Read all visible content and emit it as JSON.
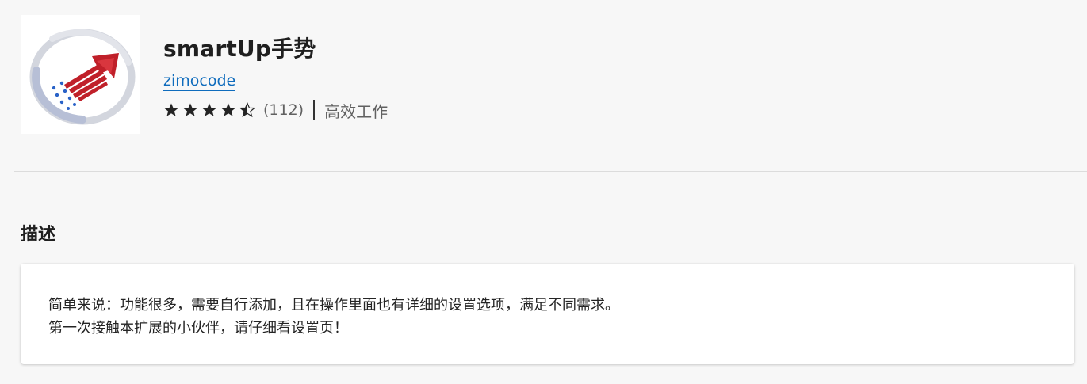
{
  "extension": {
    "title": "smartUp手势",
    "author": "zimocode",
    "rating": 4.5,
    "rating_count": "(112)",
    "category": "高效工作"
  },
  "description": {
    "heading": "描述",
    "lines": [
      "简单来说：功能很多，需要自行添加，且在操作里面也有详细的设置选项，满足不同需求。",
      "第一次接触本扩展的小伙伴，请仔细看设置页！"
    ]
  },
  "colors": {
    "background": "#f7f7f7",
    "link": "#0f6cbd",
    "logo_arrow": "#c0202a",
    "logo_ring": "#c8ccd8",
    "logo_dots": "#2a63c8"
  },
  "icons": {
    "logo": "smartup-arrow-logo",
    "star_full": "star-filled-icon",
    "star_half": "star-half-icon"
  }
}
